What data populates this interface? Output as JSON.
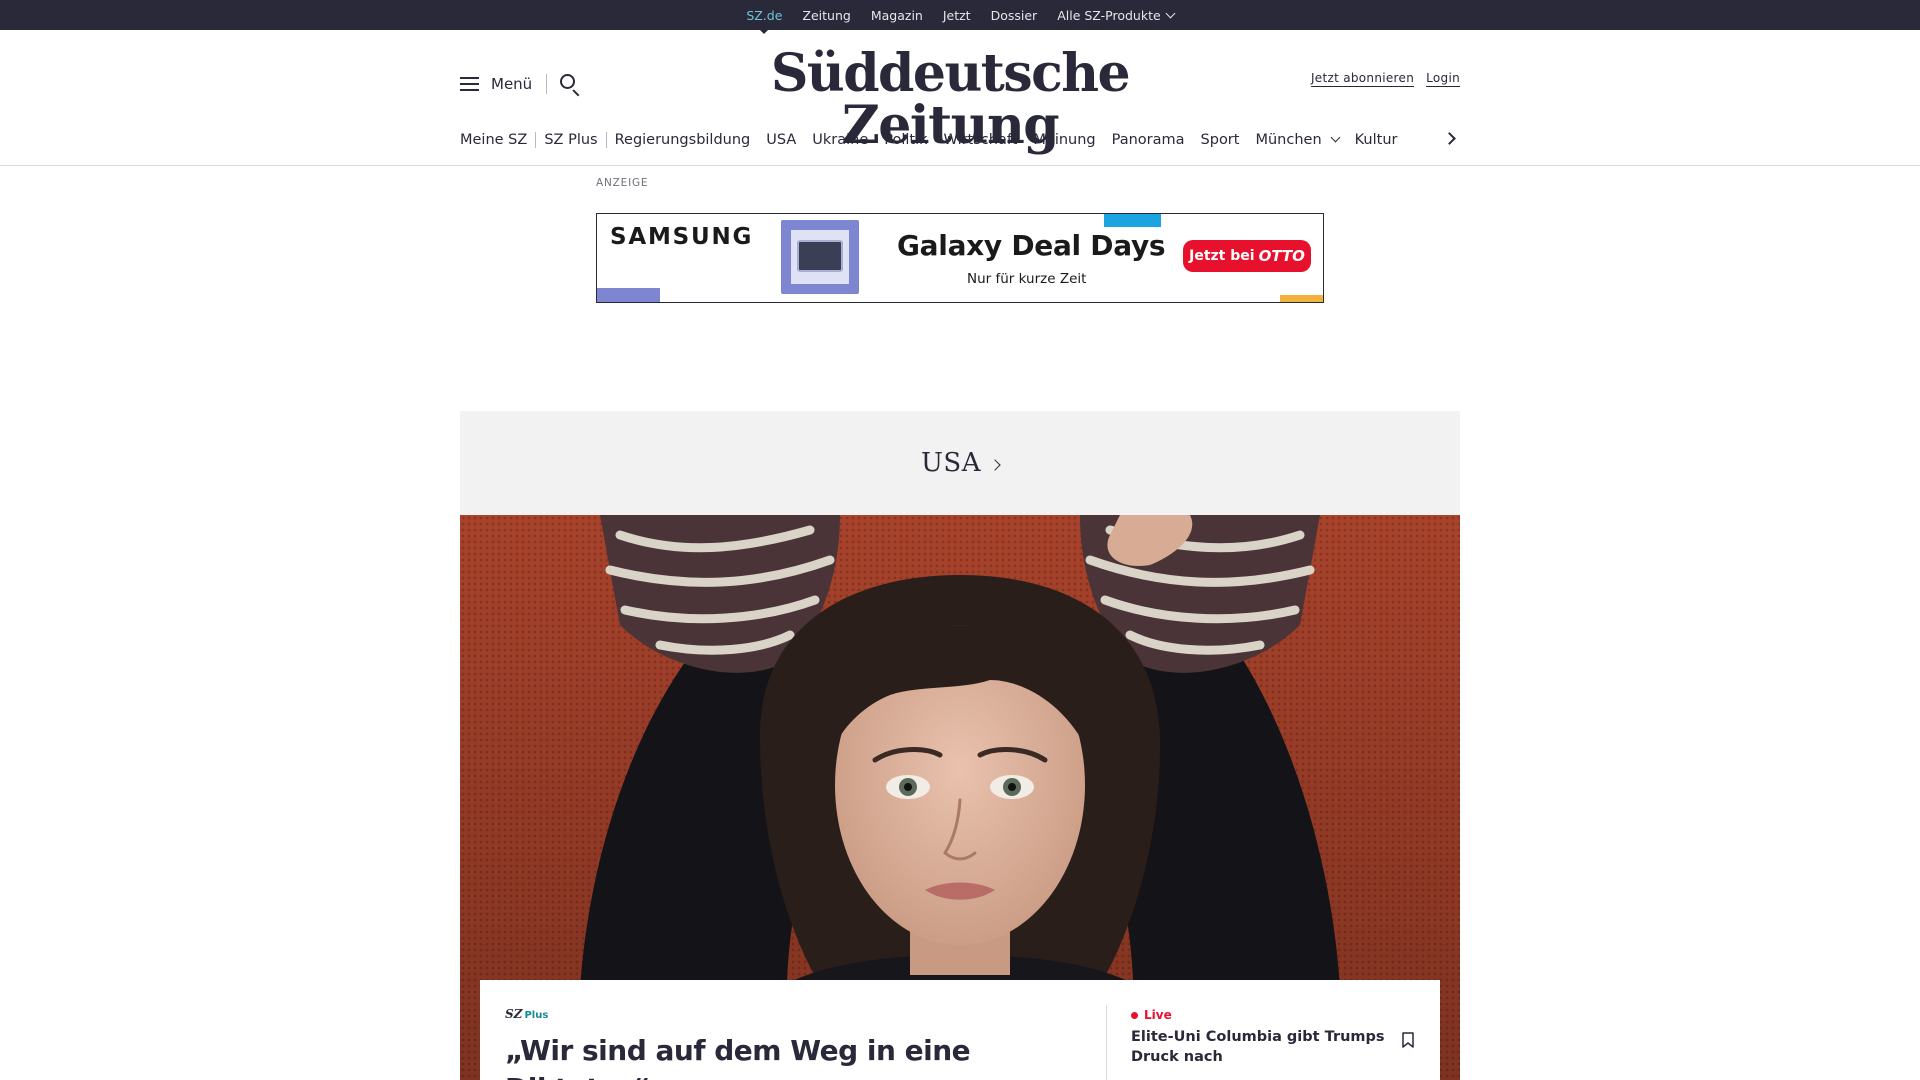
{
  "topbar": {
    "links": [
      "SZ.de",
      "Zeitung",
      "Magazin",
      "Jetzt",
      "Dossier"
    ],
    "products_label": "Alle SZ-Produkte"
  },
  "header": {
    "menu_label": "Menü",
    "logo": "Süddeutsche Zeitung",
    "subscribe_label": "Jetzt abonnieren",
    "login_label": "Login"
  },
  "nav": {
    "items": [
      "Meine SZ",
      "SZ Plus",
      "Regierungsbildung",
      "USA",
      "Ukraine",
      "Politik",
      "Wirtschaft",
      "Meinung",
      "Panorama",
      "Sport",
      "München",
      "Kultur"
    ]
  },
  "ad": {
    "label": "ANZEIGE",
    "brand": "SAMSUNG",
    "headline": "Galaxy Deal Days",
    "subline": "Nur für kurze Zeit",
    "cta_text": "Jetzt bei",
    "cta_brand": "OTTO"
  },
  "section": {
    "title": "USA"
  },
  "teaser": {
    "badge_sz": "SZ",
    "badge_plus": "Plus",
    "headline": "„Wir sind auf dem Weg in eine Diktatur“"
  },
  "side_teaser": {
    "live_label": "Live",
    "title": "Elite-Uni Columbia gibt Trumps Druck nach"
  },
  "colors": {
    "brand_dark": "#29293a",
    "accent_teal": "#71c3d8",
    "live_red": "#e8112d",
    "plus_teal": "#14899b"
  }
}
